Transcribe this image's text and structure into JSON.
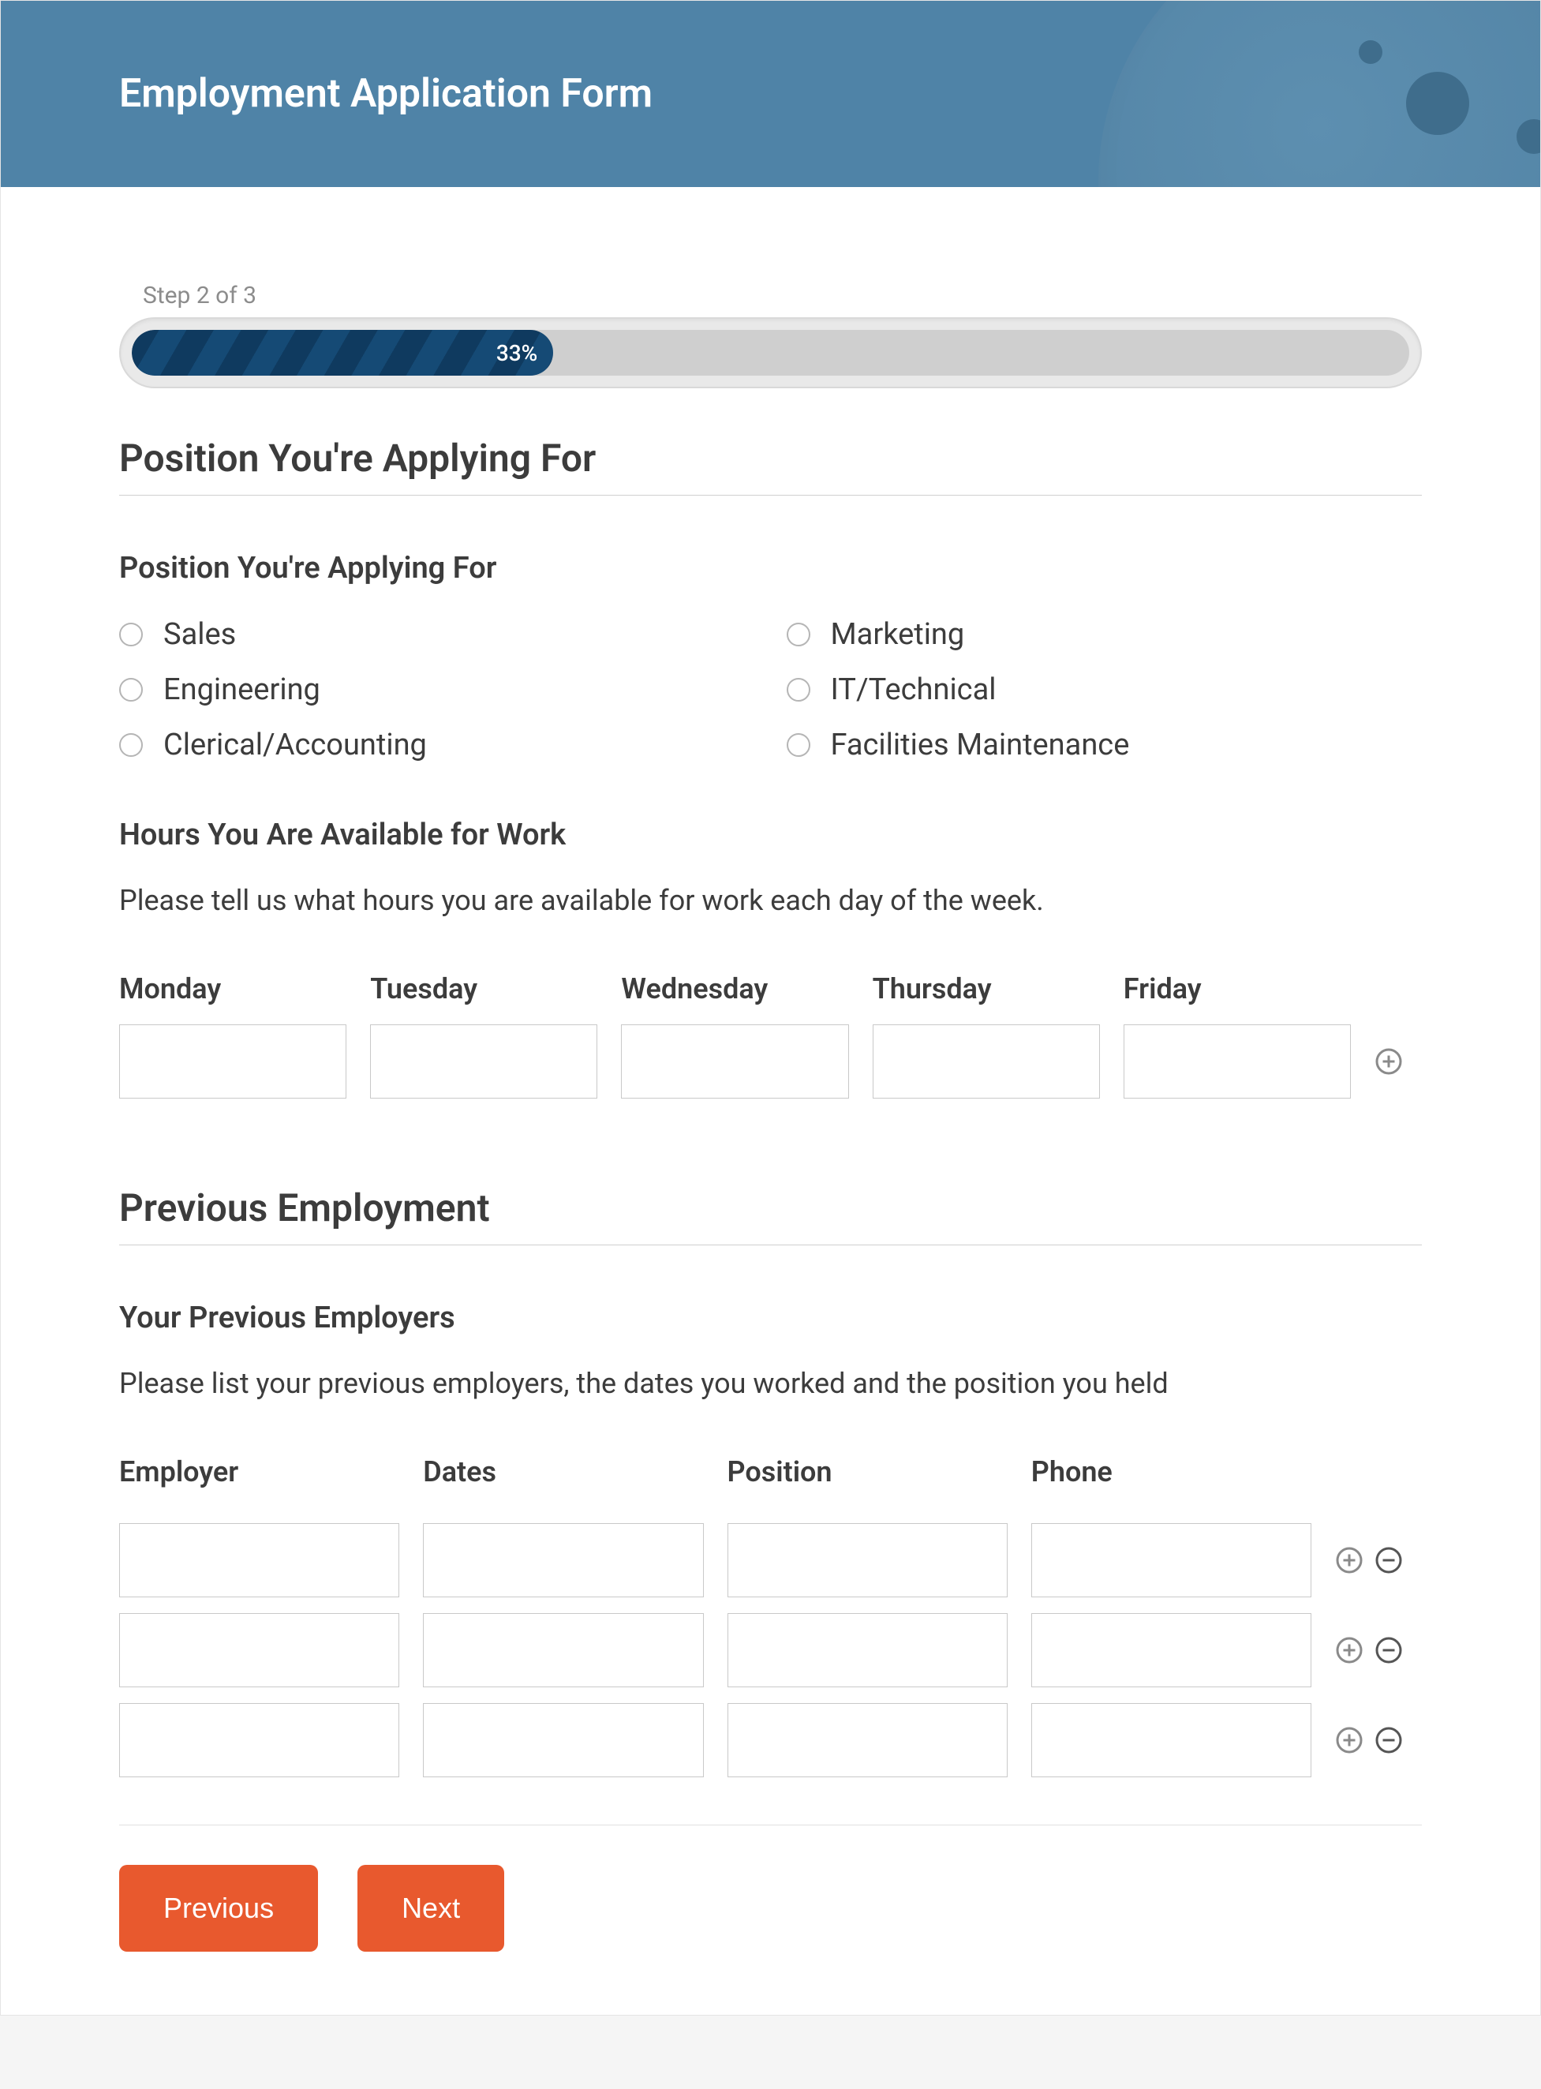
{
  "header": {
    "title": "Employment Application Form"
  },
  "progress": {
    "step_label": "Step 2 of 3",
    "percent_label": "33%",
    "percent": 33
  },
  "sections": {
    "position": {
      "title": "Position You're Applying For",
      "field_label": "Position You're Applying For",
      "options": [
        "Sales",
        "Marketing",
        "Engineering",
        "IT/Technical",
        "Clerical/Accounting",
        "Facilities Maintenance"
      ]
    },
    "hours": {
      "field_label": "Hours You Are Available for Work",
      "help": "Please tell us what hours you are available for work each day of the week.",
      "days": [
        "Monday",
        "Tuesday",
        "Wednesday",
        "Thursday",
        "Friday"
      ]
    },
    "previous": {
      "title": "Previous Employment",
      "field_label": "Your Previous Employers",
      "help": "Please list your previous employers, the dates you worked and the position you held",
      "columns": [
        "Employer",
        "Dates",
        "Position",
        "Phone"
      ],
      "row_count": 3
    }
  },
  "buttons": {
    "prev": "Previous",
    "next": "Next"
  }
}
